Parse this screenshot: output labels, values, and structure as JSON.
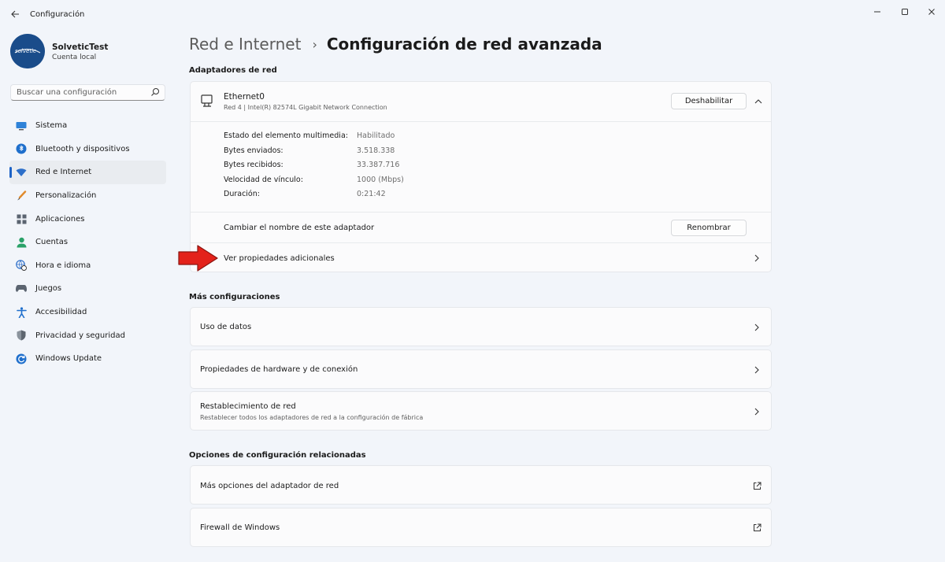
{
  "window": {
    "title": "Configuración"
  },
  "profile": {
    "name": "SolveticTest",
    "account_type": "Cuenta local",
    "avatar_text": "solvetic"
  },
  "search": {
    "placeholder": "Buscar una configuración"
  },
  "nav": {
    "items": [
      {
        "label": "Sistema",
        "icon": "monitor-icon"
      },
      {
        "label": "Bluetooth y dispositivos",
        "icon": "bluetooth-icon"
      },
      {
        "label": "Red e Internet",
        "icon": "wifi-icon",
        "active": true
      },
      {
        "label": "Personalización",
        "icon": "brush-icon"
      },
      {
        "label": "Aplicaciones",
        "icon": "apps-icon"
      },
      {
        "label": "Cuentas",
        "icon": "person-icon"
      },
      {
        "label": "Hora e idioma",
        "icon": "globe-clock-icon"
      },
      {
        "label": "Juegos",
        "icon": "gamepad-icon"
      },
      {
        "label": "Accesibilidad",
        "icon": "accessibility-icon"
      },
      {
        "label": "Privacidad y seguridad",
        "icon": "shield-icon"
      },
      {
        "label": "Windows Update",
        "icon": "update-icon"
      }
    ]
  },
  "breadcrumb": {
    "parent": "Red e Internet",
    "separator": "›",
    "current": "Configuración de red avanzada"
  },
  "adapters": {
    "section_title": "Adaptadores de red",
    "name": "Ethernet0",
    "description": "Red 4 | Intel(R) 82574L Gigabit Network Connection",
    "disable_label": "Deshabilitar",
    "properties": [
      {
        "label": "Estado del elemento multimedia:",
        "value": "Habilitado"
      },
      {
        "label": "Bytes enviados:",
        "value": "3.518.338"
      },
      {
        "label": "Bytes recibidos:",
        "value": "33.387.716"
      },
      {
        "label": "Velocidad de vínculo:",
        "value": "1000 (Mbps)"
      },
      {
        "label": "Duración:",
        "value": "0:21:42"
      }
    ],
    "rename_label": "Cambiar el nombre de este adaptador",
    "rename_button": "Renombrar",
    "more_props_label": "Ver propiedades adicionales"
  },
  "more": {
    "section_title": "Más configuraciones",
    "data_usage": "Uso de datos",
    "hw_props": "Propiedades de hardware y de conexión",
    "reset_title": "Restablecimiento de red",
    "reset_sub": "Restablecer todos los adaptadores de red a la configuración de fábrica"
  },
  "related": {
    "section_title": "Opciones de configuración relacionadas",
    "adapter_options": "Más opciones del adaptador de red",
    "firewall": "Firewall de Windows"
  },
  "colors": {
    "accent": "#1d62c6",
    "annotation_arrow": "#e3221b"
  }
}
